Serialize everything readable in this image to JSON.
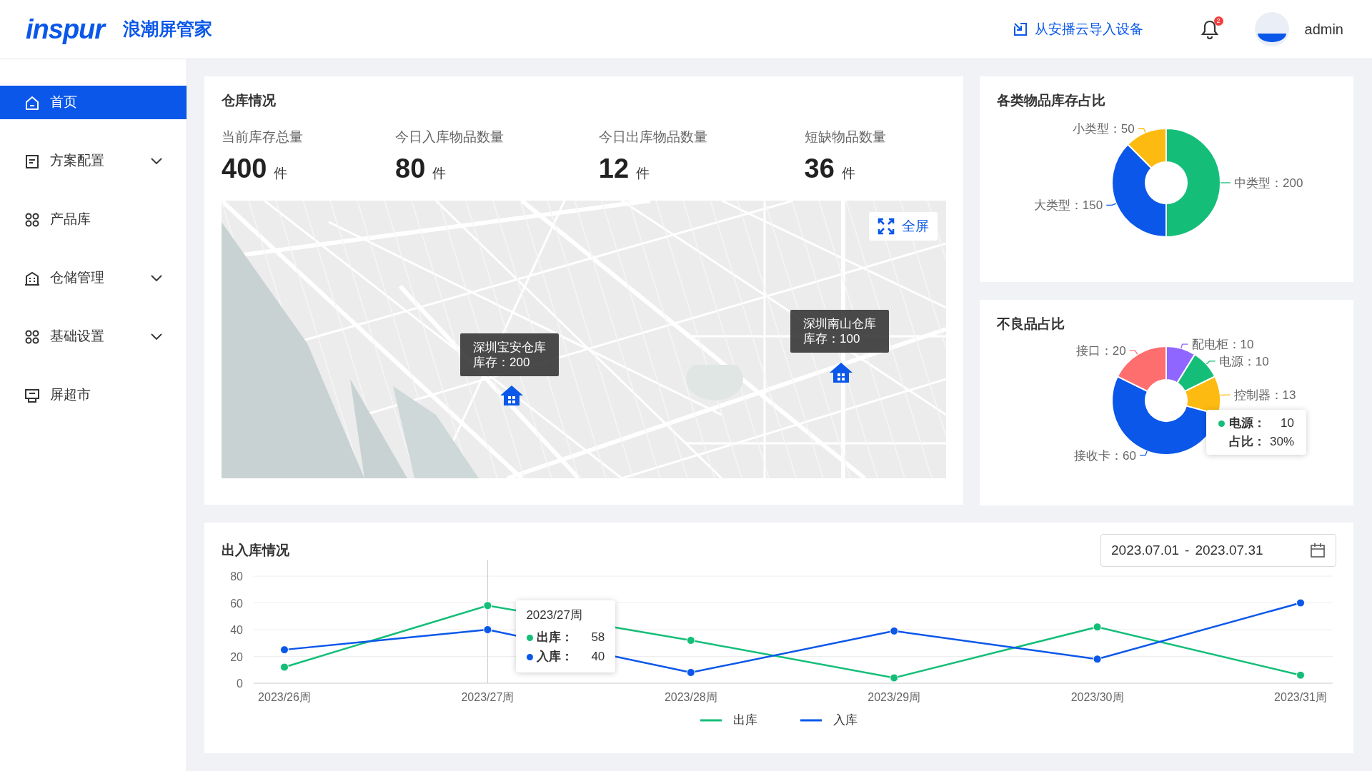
{
  "header": {
    "logo": "inspur",
    "app_name": "浪潮屏管家",
    "import_link": "从安播云导入设备",
    "notification_count": "2",
    "user": "admin"
  },
  "sidebar": {
    "items": [
      {
        "label": "首页",
        "kind": "link",
        "selected": true
      },
      {
        "label": "方案配置",
        "kind": "menu",
        "selected": false
      },
      {
        "label": "产品库",
        "kind": "link",
        "selected": false
      },
      {
        "label": "仓储管理",
        "kind": "menu",
        "selected": false
      },
      {
        "label": "基础设置",
        "kind": "menu",
        "selected": false
      },
      {
        "label": "屏超市",
        "kind": "link",
        "selected": false
      }
    ]
  },
  "warehouse": {
    "title": "仓库情况",
    "stats": [
      {
        "label": "当前库存总量",
        "value": "400",
        "unit": "件"
      },
      {
        "label": "今日入库物品数量",
        "value": "80",
        "unit": "件"
      },
      {
        "label": "今日出库物品数量",
        "value": "12",
        "unit": "件"
      },
      {
        "label": "短缺物品数量",
        "value": "36",
        "unit": "件"
      }
    ],
    "map": {
      "fullscreen_button": "全屏",
      "markers": [
        {
          "name": "深圳宝安仓库",
          "stock": "库存：200"
        },
        {
          "name": "深圳南山仓库",
          "stock": "库存：100"
        }
      ]
    }
  },
  "inventory_share": {
    "title": "各类物品库存占比",
    "label_separator": "：",
    "chart_data": {
      "type": "donut",
      "categories": [
        "中类型",
        "大类型",
        "小类型"
      ],
      "values": [
        200,
        150,
        50
      ],
      "colors": [
        "#14be79",
        "#0a57e9",
        "#fdbb11"
      ],
      "data_labels": true
    }
  },
  "defect_share": {
    "title": "不良品占比",
    "label_separator": "：",
    "chart_data": {
      "type": "donut",
      "categories": [
        "配电柜",
        "电源",
        "控制器",
        "接收卡",
        "接口"
      ],
      "values": [
        10,
        10,
        13,
        60,
        20
      ],
      "colors": [
        "#8f66ff",
        "#14be79",
        "#fdbb11",
        "#0a57e9",
        "#ff6e6e"
      ],
      "data_labels": true
    },
    "tooltip": {
      "name": "电源：",
      "value": "10",
      "share_label": "占比：",
      "share": "30%",
      "color": "#14be79"
    }
  },
  "flow": {
    "title": "出入库情况",
    "date_range": {
      "start": "2023.07.01",
      "separator": "-",
      "end": "2023.07.31"
    },
    "chart_data": {
      "type": "line",
      "categories": [
        "2023/26周",
        "2023/27周",
        "2023/28周",
        "2023/29周",
        "2023/30周",
        "2023/31周"
      ],
      "series": [
        {
          "name": "出库",
          "color": "#14be79",
          "marker": "circle",
          "values": [
            12,
            58,
            32,
            4,
            42,
            6
          ]
        },
        {
          "name": "入库",
          "color": "#0a57e9",
          "marker": "circle",
          "values": [
            25,
            40,
            8,
            39,
            18,
            60
          ]
        }
      ],
      "ylim": [
        0,
        80
      ],
      "yticks": [
        0,
        20,
        40,
        60,
        80
      ],
      "grid": true,
      "ref_lines": [
        {
          "axis": "x",
          "value": "2023/27周"
        }
      ]
    },
    "tooltip": {
      "title": "2023/27周",
      "rows": [
        {
          "label": "出库：",
          "value": "58",
          "color": "#14be79"
        },
        {
          "label": "入库：",
          "value": "40",
          "color": "#0a57e9"
        }
      ]
    }
  }
}
